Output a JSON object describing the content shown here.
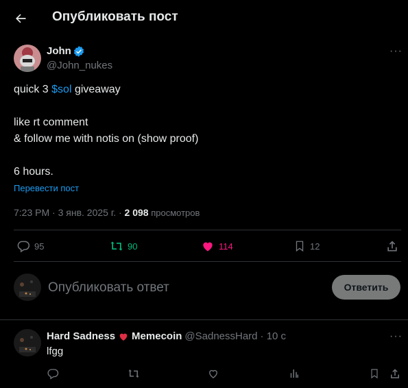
{
  "header": {
    "title": "Опубликовать пост"
  },
  "post": {
    "author_name": "John",
    "author_handle": "@John_nukes",
    "text_line1_prefix": "quick 3 ",
    "text_line1_link": "$sol",
    "text_line1_suffix": " giveaway",
    "text_line2": "like rt comment",
    "text_line3": "& follow me with notis on (show proof)",
    "text_line4": "6 hours.",
    "translate": "Перевести пост",
    "meta_time": "7:23 PM · 3 янв. 2025 г. · ",
    "meta_views_count": "2 098",
    "meta_views_label": " просмотров",
    "stats": {
      "replies": "95",
      "reposts": "90",
      "likes": "114",
      "bookmarks": "12"
    }
  },
  "composer": {
    "placeholder": "Опубликовать ответ",
    "button": "Ответить"
  },
  "reply": {
    "author_name_part1": "Hard Sadness",
    "author_name_part2": "Memecoin",
    "author_handle": "@SadnessHard",
    "time": "· 10 с",
    "text": "lfgg"
  },
  "colors": {
    "verified": "#1d9bf0",
    "like": "#f91880",
    "repost": "#00ba7c",
    "muted": "#71767b"
  }
}
